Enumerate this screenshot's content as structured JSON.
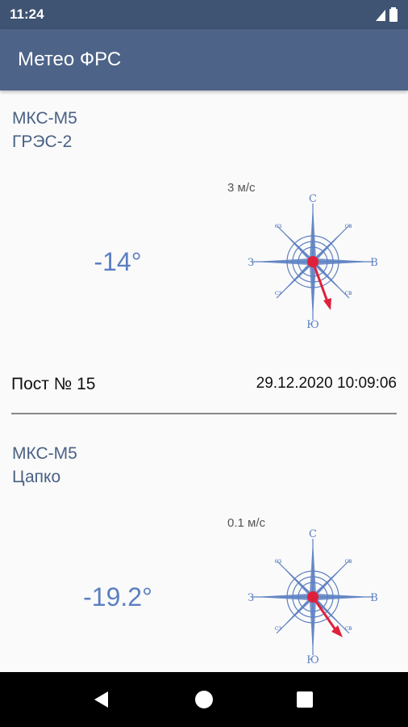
{
  "status_bar": {
    "time": "11:24"
  },
  "app_bar": {
    "title": "Метео ФРС"
  },
  "stations": [
    {
      "model": "МКС-М5",
      "place": "ГРЭС-2",
      "wind_speed": "3 м/с",
      "temperature": "-14°",
      "post": "Пост № 15",
      "datetime": "29.12.2020 10:09:06"
    },
    {
      "model": "МКС-М5",
      "place": "Цапко",
      "wind_speed": "0.1 м/с",
      "temperature": "-19.2°"
    }
  ],
  "compass_labels": {
    "north": "С",
    "south": "Ю",
    "west": "З",
    "east": "В",
    "nw": "сз",
    "ne": "св",
    "sw": "сз",
    "se": "св"
  },
  "colors": {
    "status_bar": "#3f5372",
    "app_bar": "#4d6388",
    "rose": "#5b7fc2",
    "arrow": "#e0203a"
  },
  "icons": [
    "signal-icon",
    "battery-icon",
    "compass-rose-icon",
    "wind-arrow-icon",
    "back-icon",
    "home-icon",
    "recents-icon"
  ]
}
